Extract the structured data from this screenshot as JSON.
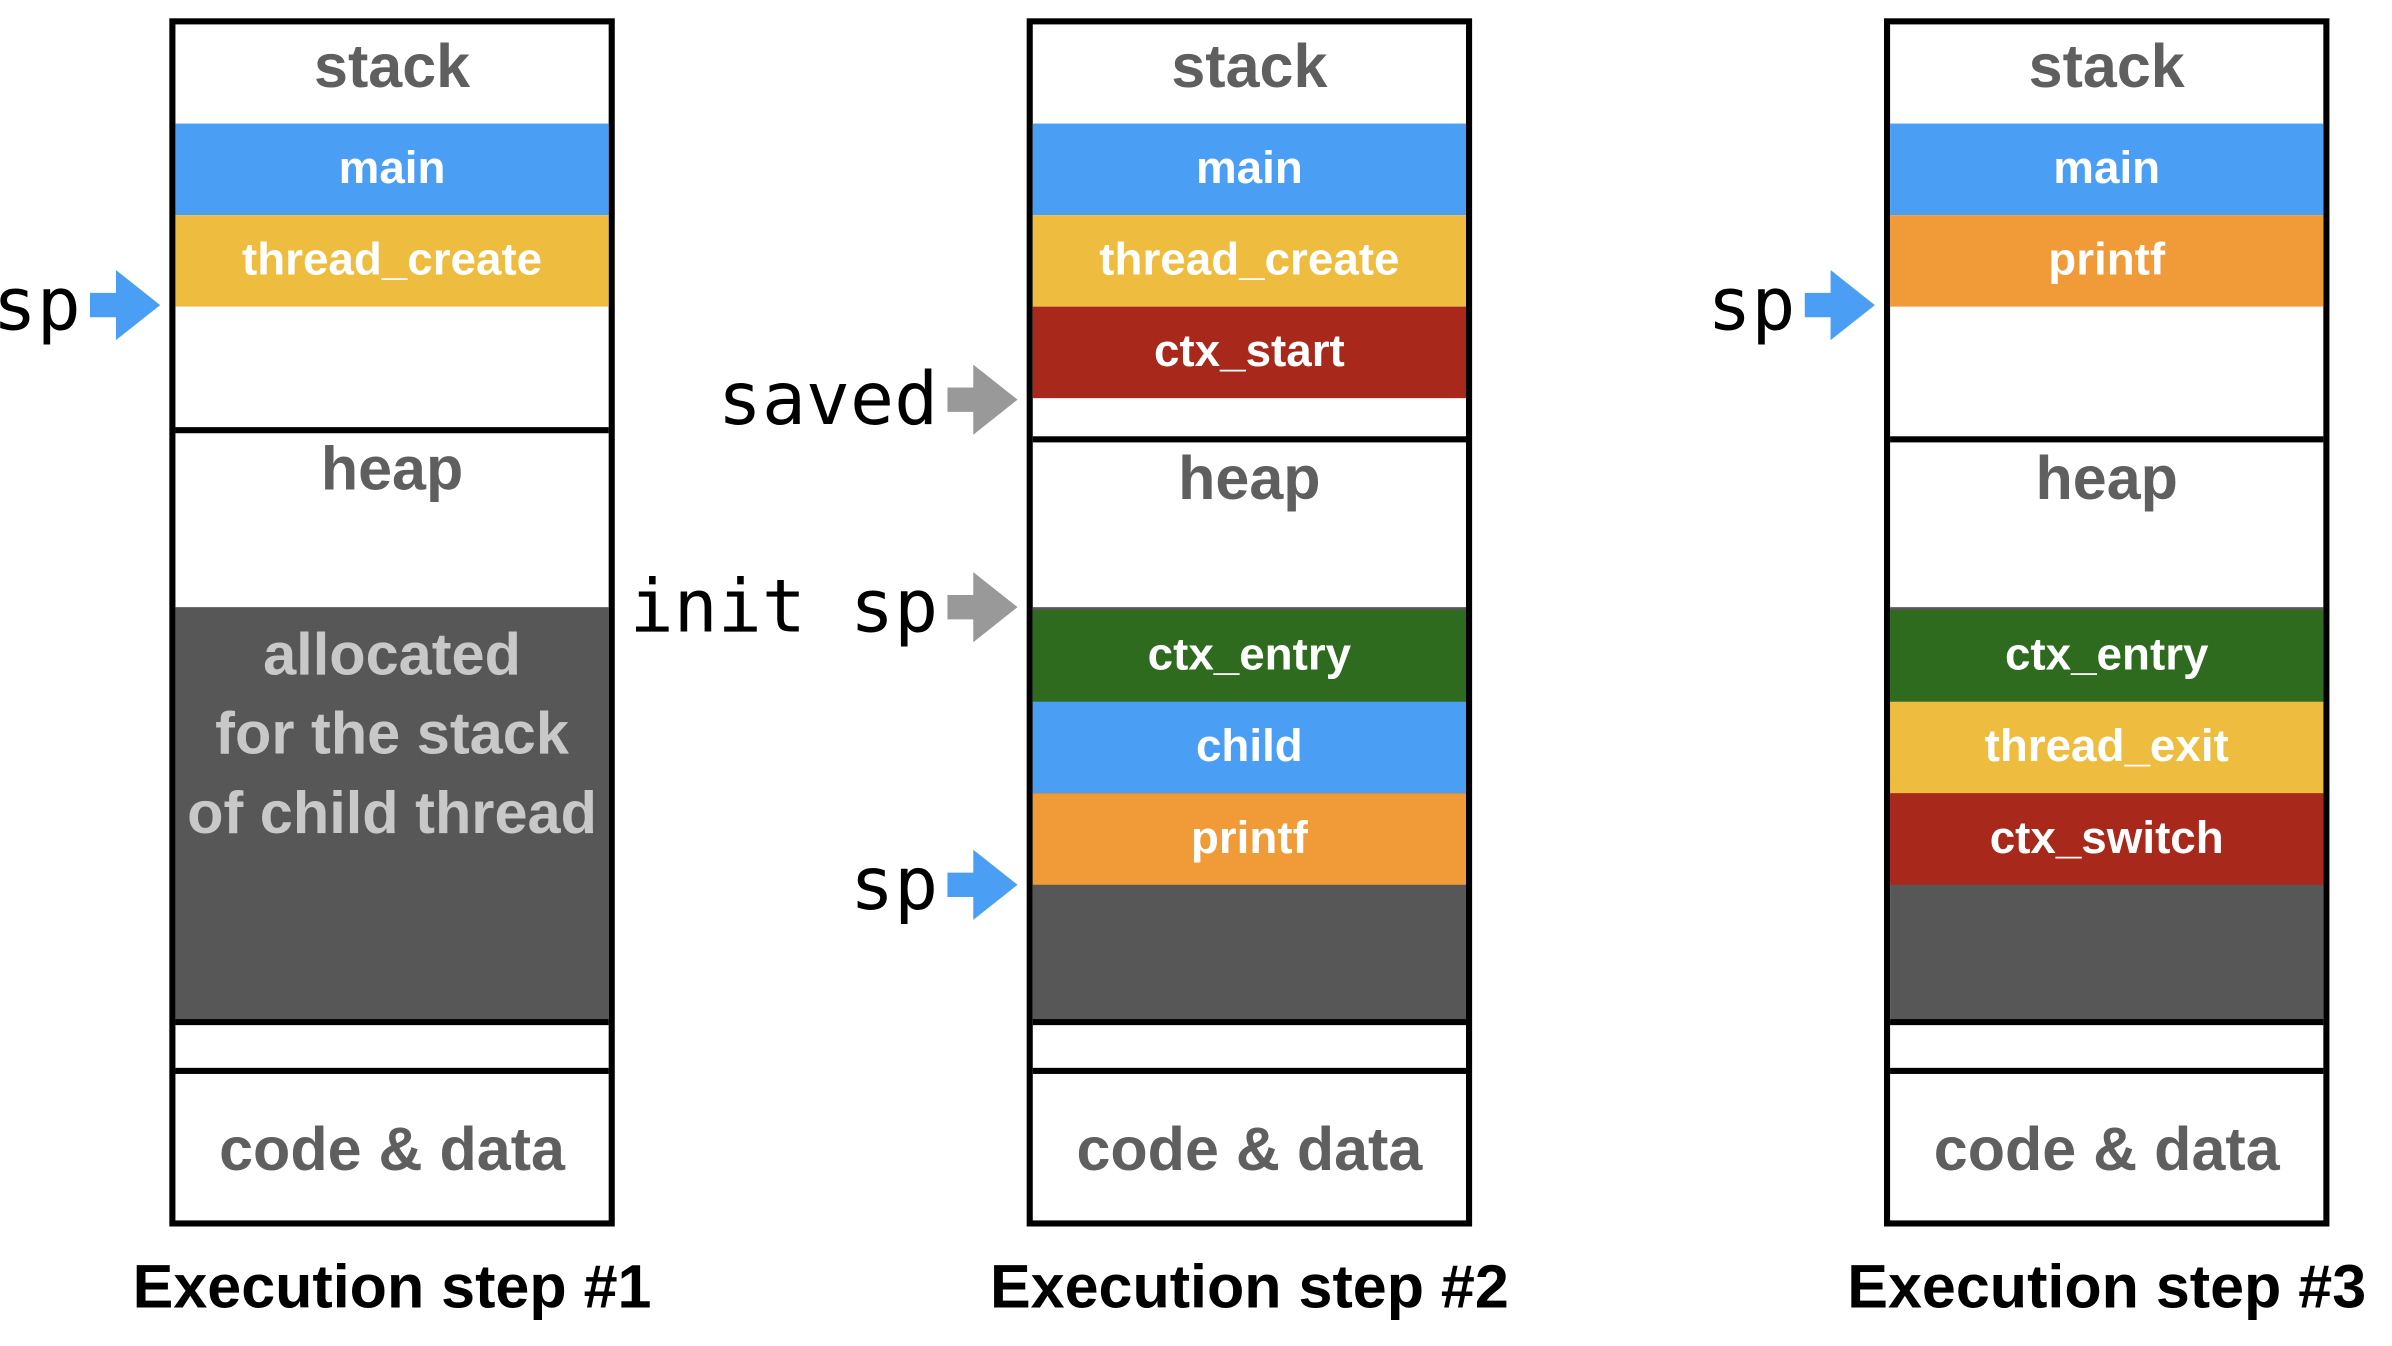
{
  "colors": {
    "main": "#4A9FF5",
    "yellow": "#EEBD40",
    "red": "#A8291B",
    "orange": "#F09A38",
    "green": "#2E6B1E",
    "blue_arrow": "#4A9FF5",
    "gray_arrow": "#999999",
    "allocated": "#575757"
  },
  "labels": {
    "stack": "stack",
    "heap": "heap",
    "code": "code & data",
    "allocated": [
      "allocated",
      "for the stack",
      "of child thread"
    ]
  },
  "steps": [
    {
      "title": "Execution step #1",
      "stack_frames": [
        {
          "name": "main",
          "color": "main"
        },
        {
          "name": "thread_create",
          "color": "yellow"
        }
      ],
      "child_frames": [],
      "pointers": [
        {
          "label": "sp",
          "at": "stack_top",
          "color": "blue_arrow"
        }
      ]
    },
    {
      "title": "Execution step #2",
      "stack_frames": [
        {
          "name": "main",
          "color": "main"
        },
        {
          "name": "thread_create",
          "color": "yellow"
        },
        {
          "name": "ctx_start",
          "color": "red"
        }
      ],
      "child_frames": [
        {
          "name": "ctx_entry",
          "color": "green"
        },
        {
          "name": "child",
          "color": "main"
        },
        {
          "name": "printf",
          "color": "orange"
        }
      ],
      "pointers": [
        {
          "label": "saved",
          "at": "stack_top",
          "color": "gray_arrow"
        },
        {
          "label": "init sp",
          "at": "child_base",
          "color": "gray_arrow"
        },
        {
          "label": "sp",
          "at": "child_top",
          "color": "blue_arrow"
        }
      ]
    },
    {
      "title": "Execution step #3",
      "stack_frames": [
        {
          "name": "main",
          "color": "main"
        },
        {
          "name": "printf",
          "color": "orange"
        }
      ],
      "child_frames": [
        {
          "name": "ctx_entry",
          "color": "green"
        },
        {
          "name": "thread_exit",
          "color": "yellow"
        },
        {
          "name": "ctx_switch",
          "color": "red"
        }
      ],
      "pointers": [
        {
          "label": "sp",
          "at": "stack_top",
          "color": "blue_arrow"
        }
      ]
    }
  ]
}
